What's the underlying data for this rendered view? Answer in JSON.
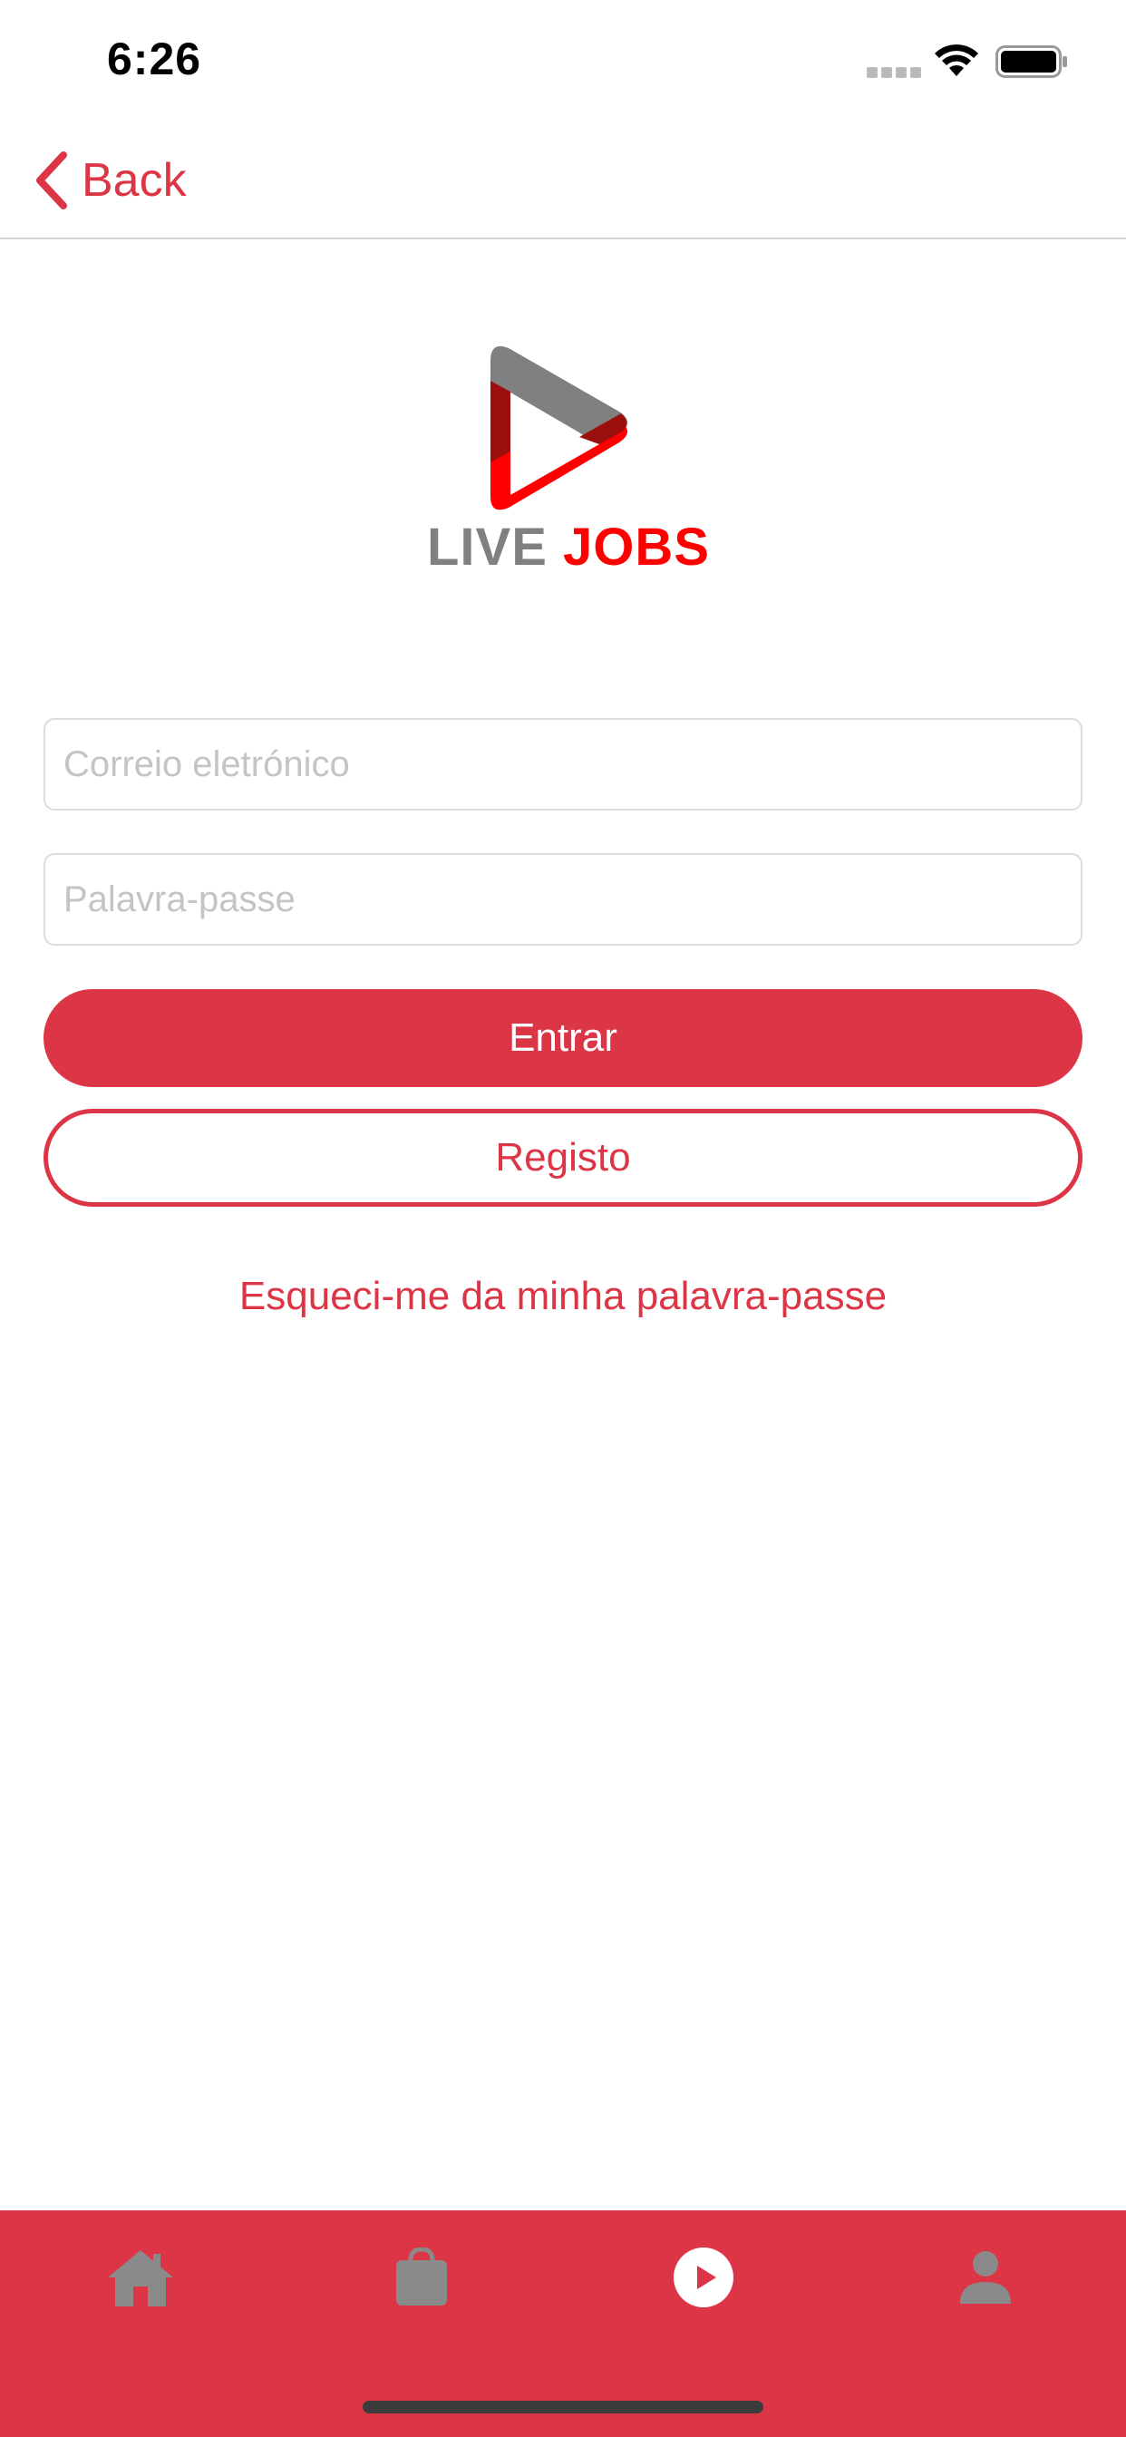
{
  "status_bar": {
    "time": "6:26"
  },
  "nav": {
    "back_label": "Back"
  },
  "logo": {
    "word_1": "LIVE",
    "word_2": "JOBS",
    "colors": {
      "live": "#808080",
      "jobs": "#ff0000"
    }
  },
  "form": {
    "email_placeholder": "Correio eletrónico",
    "email_value": "",
    "password_placeholder": "Palavra-passe",
    "password_value": "",
    "login_label": "Entrar",
    "register_label": "Registo",
    "forgot_label": "Esqueci-me da minha palavra-passe"
  },
  "tab_bar": {
    "items": [
      {
        "icon": "home-icon",
        "active": false
      },
      {
        "icon": "briefcase-icon",
        "active": false
      },
      {
        "icon": "play-circle-icon",
        "active": true
      },
      {
        "icon": "person-icon",
        "active": false
      }
    ]
  },
  "colors": {
    "accent": "#dc3545",
    "tab_inactive": "#8a8a8a",
    "tab_active": "#ffffff"
  }
}
